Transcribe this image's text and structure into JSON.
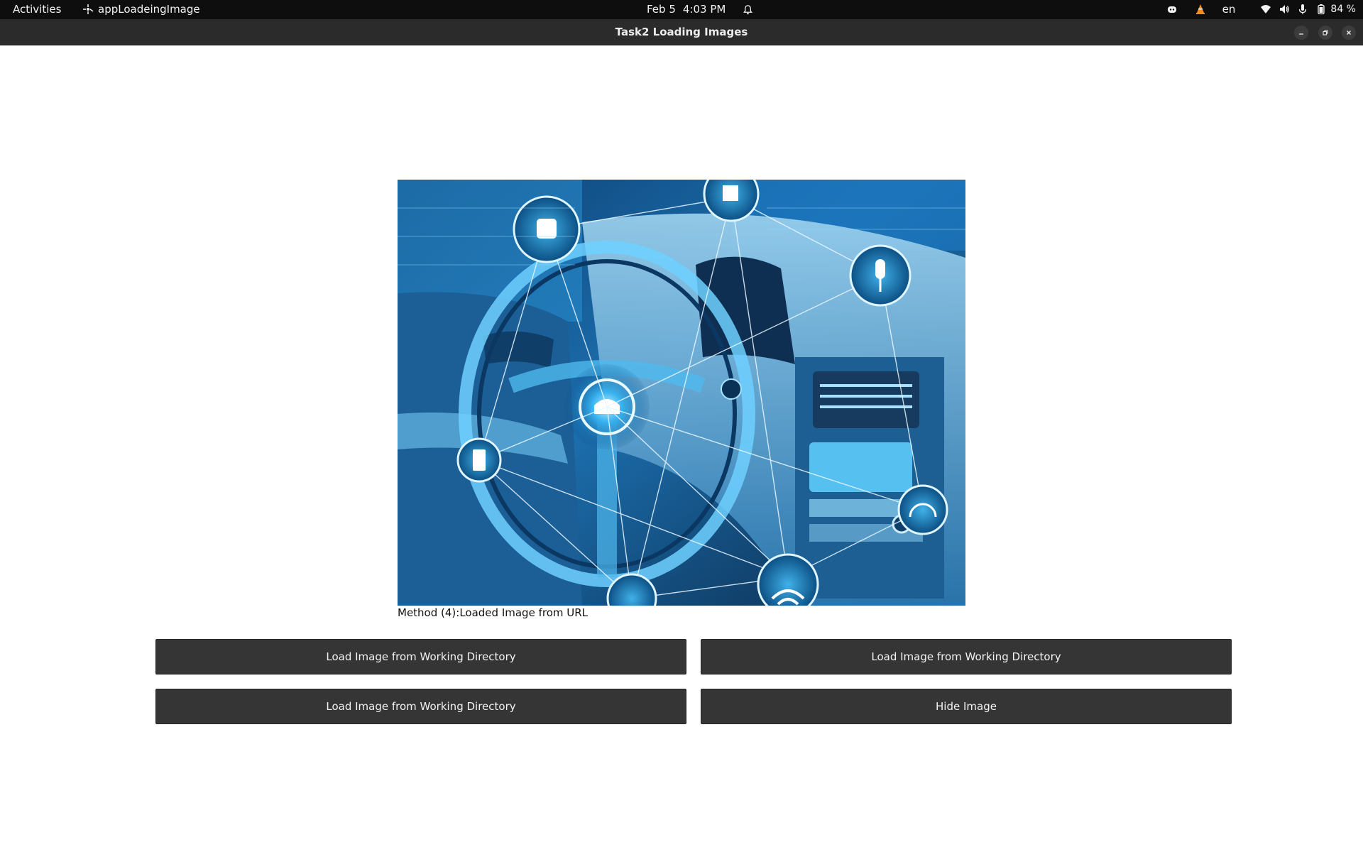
{
  "topbar": {
    "activities_label": "Activities",
    "app_name": "appLoadeingImage",
    "date": "Feb 5",
    "time": "4:03 PM",
    "language": "en",
    "battery_percent": "84 %"
  },
  "window": {
    "title": "Task2 Loading Images"
  },
  "image": {
    "caption": "Method (4):Loaded Image from URL"
  },
  "buttons": {
    "b1": "Load Image from Working Directory",
    "b2": "Load Image from Working Directory",
    "b3": "Load Image from Working Directory",
    "b4": "Hide Image"
  },
  "colors": {
    "topbar_bg": "#0e0e0e",
    "titlebar_bg": "#2b2b2b",
    "button_bg": "#353535",
    "image_accent": "#2ea9e6"
  }
}
